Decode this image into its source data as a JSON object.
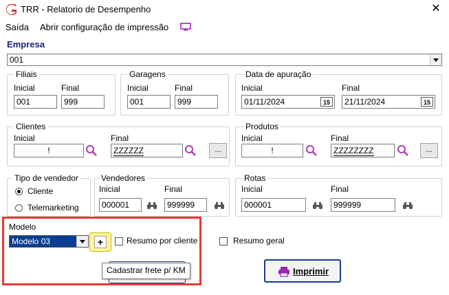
{
  "window": {
    "title": "TRR - Relatorio de Desempenho",
    "close_glyph": "✕"
  },
  "menu": {
    "items": [
      "Saída",
      "Abrir configuração de impressão"
    ]
  },
  "empresa": {
    "label": "Empresa",
    "value": "001"
  },
  "filiais": {
    "title": "Filiais",
    "inicial_label": "Inicial",
    "final_label": "Final",
    "inicial": "001",
    "final": "999"
  },
  "garagens": {
    "title": "Garagens",
    "inicial_label": "Inicial",
    "final_label": "Final",
    "inicial": "001",
    "final": "999"
  },
  "data_apuracao": {
    "title": "Data de apuração",
    "inicial_label": "Inicial",
    "final_label": "Final",
    "inicial": "01/11/2024",
    "final": "21/11/2024",
    "cal_glyph": "15"
  },
  "clientes": {
    "title": "Clientes",
    "inicial_label": "Inicial",
    "final_label": "Final",
    "inicial": "!",
    "final": "ZZZZZZ",
    "more_label": "..."
  },
  "produtos": {
    "title": "Produtos",
    "inicial_label": "Inicial",
    "final_label": "Final",
    "inicial": "!",
    "final": "ZZZZZZZZ",
    "more_label": "..."
  },
  "tipo_vendedor": {
    "title": "Tipo de vendedor",
    "options": [
      "Cliente",
      "Telemarketing"
    ],
    "selected": "Cliente"
  },
  "vendedores": {
    "title": "Vendedores",
    "inicial_label": "Inicial",
    "final_label": "Final",
    "inicial": "000001",
    "final": "999999"
  },
  "rotas": {
    "title": "Rotas",
    "inicial_label": "Inicial",
    "final_label": "Final",
    "inicial": "000001",
    "final": "999999"
  },
  "modelo": {
    "label": "Modelo",
    "value": "Modelo 03",
    "add_glyph": "+"
  },
  "options": {
    "resumo_cliente": "Resumo por cliente",
    "resumo_geral": "Resumo geral"
  },
  "tooltip": {
    "text": "Cadastrar frete p/ KM"
  },
  "print_button": {
    "label": "Imprimir"
  },
  "colors": {
    "highlight": "#e53935",
    "accent": "#1a237e",
    "search_icon": "#b03ab5",
    "tooltip_target": "#fff59d"
  }
}
